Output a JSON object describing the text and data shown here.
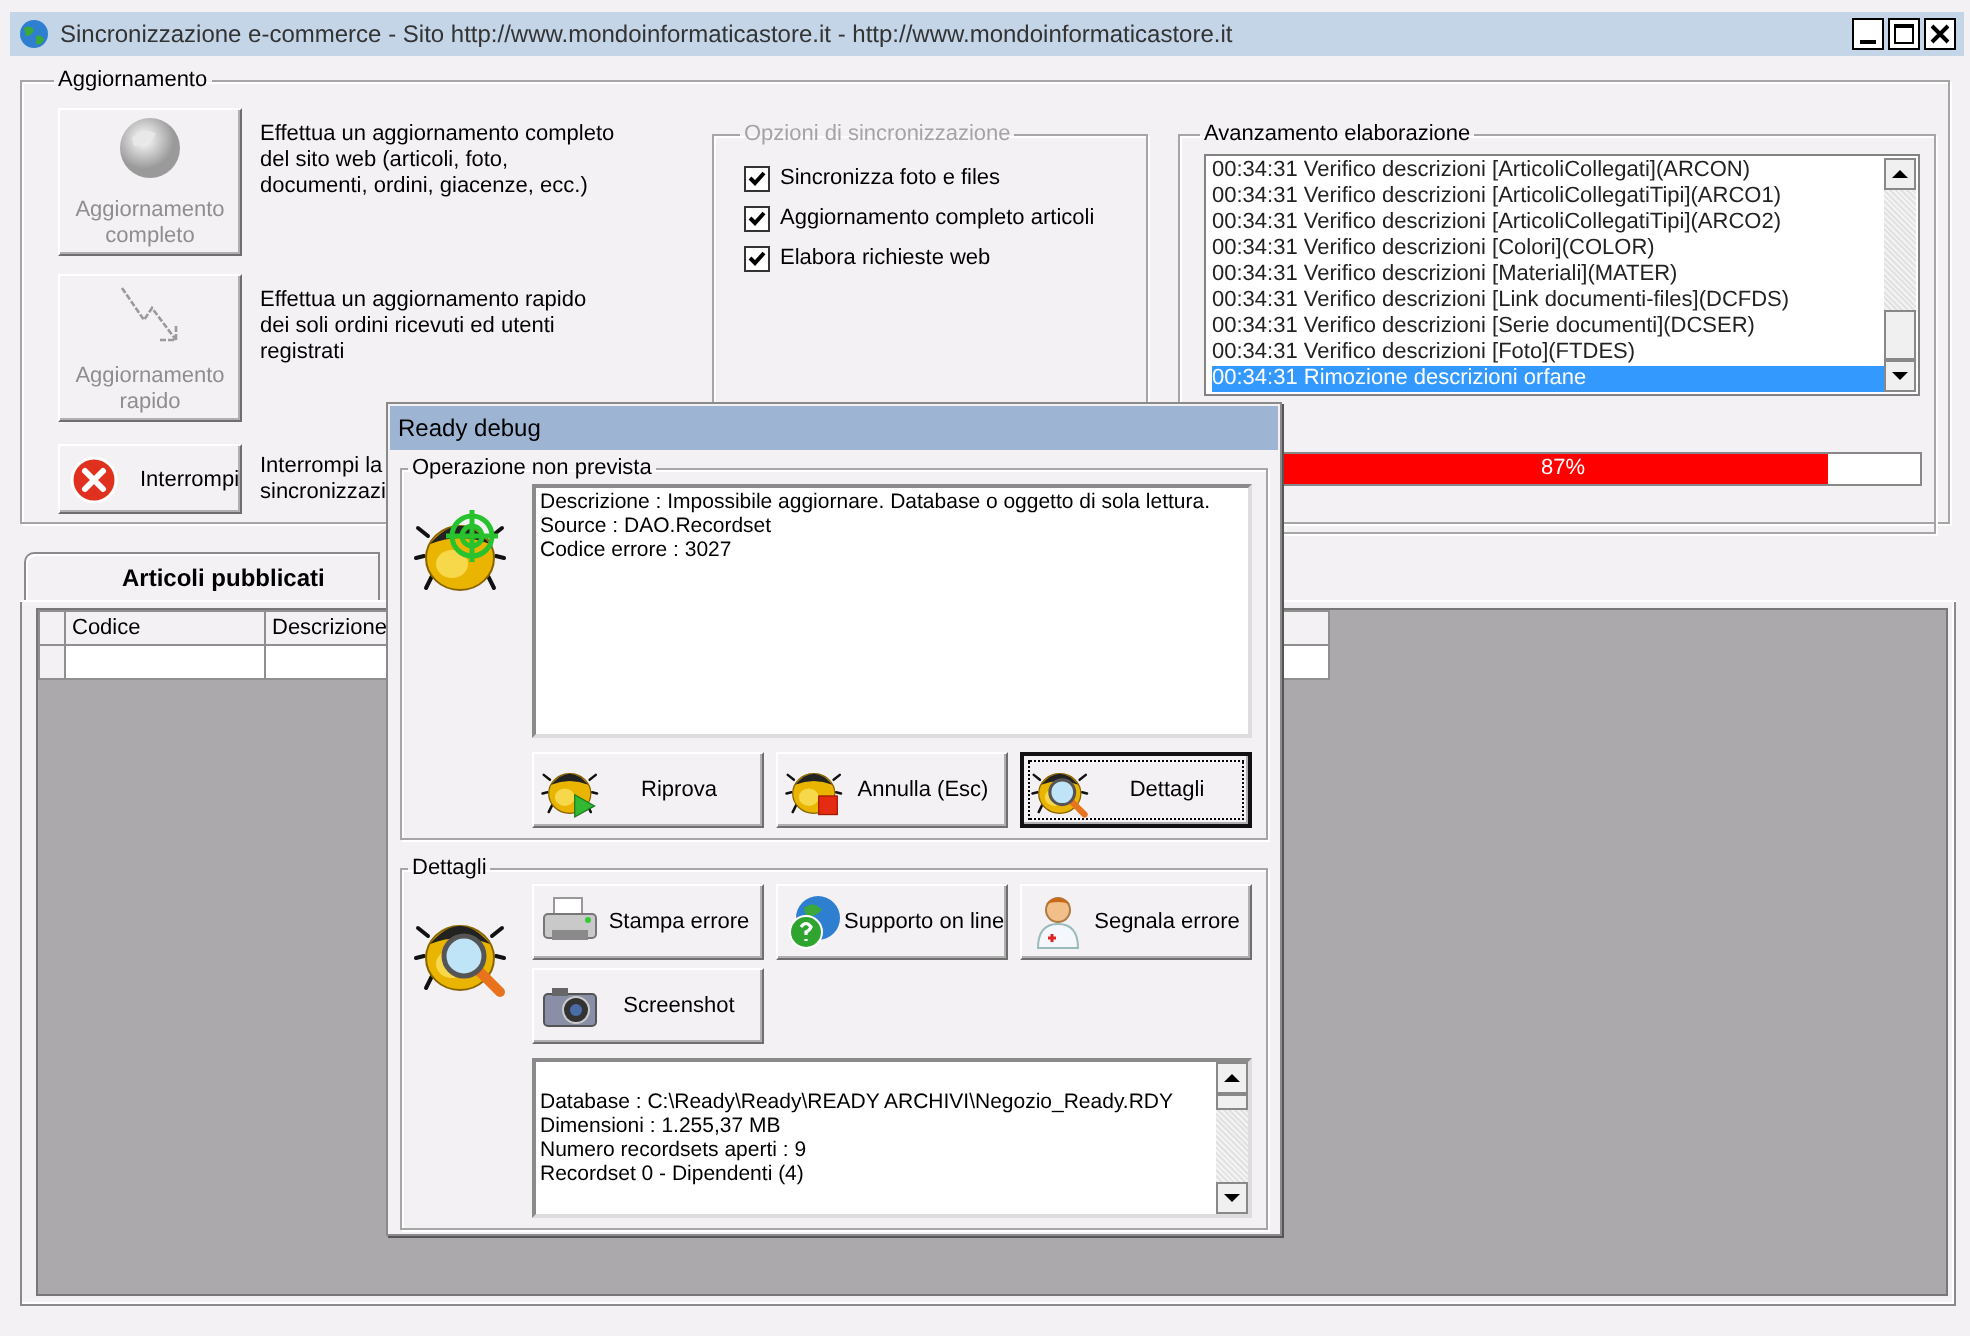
{
  "window": {
    "title": "Sincronizzazione e-commerce - Sito http://www.mondoinformaticastore.it - http://www.mondoinformaticastore.it"
  },
  "update_group": {
    "title": "Aggiornamento",
    "actions": [
      {
        "kind": "full",
        "label": "Aggiornamento completo",
        "description": "Effettua un aggiornamento completo del sito web (articoli, foto, documenti, ordini, giacenze, ecc.)",
        "disabled": true
      },
      {
        "kind": "quick",
        "label": "Aggiornamento rapido",
        "description": "Effettua un aggiornamento rapido dei soli ordini ricevuti ed utenti registrati",
        "disabled": true
      },
      {
        "kind": "stop",
        "label": "Interrompi",
        "description": "Interrompi la\nsincronizzazi",
        "disabled": false
      }
    ],
    "sync_options": {
      "title": "Opzioni di sincronizzazione",
      "disabled": true,
      "options": [
        {
          "label": "Sincronizza foto e files",
          "checked": true
        },
        {
          "label": "Aggiornamento completo articoli",
          "checked": true
        },
        {
          "label": "Elabora richieste web",
          "checked": true
        }
      ]
    },
    "progress": {
      "title": "Avanzamento elaborazione",
      "log": [
        {
          "text": "00:34:31 Verifico descrizioni [ArticoliCollegati](ARCON)",
          "selected": false
        },
        {
          "text": "00:34:31 Verifico descrizioni [ArticoliCollegatiTipi](ARCO1)",
          "selected": false
        },
        {
          "text": "00:34:31 Verifico descrizioni [ArticoliCollegatiTipi](ARCO2)",
          "selected": false
        },
        {
          "text": "00:34:31 Verifico descrizioni [Colori](COLOR)",
          "selected": false
        },
        {
          "text": "00:34:31 Verifico descrizioni [Materiali](MATER)",
          "selected": false
        },
        {
          "text": "00:34:31 Verifico descrizioni [Link documenti-files](DCFDS)",
          "selected": false
        },
        {
          "text": "00:34:31 Verifico descrizioni [Serie documenti](DCSER)",
          "selected": false
        },
        {
          "text": "00:34:31 Verifico descrizioni [Foto](FTDES)",
          "selected": false
        },
        {
          "text": "00:34:31 Rimozione descrizioni orfane",
          "selected": true
        }
      ],
      "level": 0.87,
      "reading": "87%"
    }
  },
  "tabs": [
    {
      "label": "Articoli pubblicati",
      "selected": true
    }
  ],
  "table": {
    "columns": [
      {
        "label": "Codice"
      },
      {
        "label": "Descrizione"
      }
    ]
  },
  "dialog": {
    "title": "Ready debug",
    "error_group": {
      "title": "Operazione non prevista",
      "message": [
        "Descrizione : Impossibile aggiornare. Database o oggetto di sola lettura.",
        "Source : DAO.Recordset",
        "Codice errore : 3027"
      ],
      "buttons": [
        {
          "kind": "retry",
          "label": "Riprova",
          "default": false
        },
        {
          "kind": "cancel",
          "label": "Annulla (Esc)",
          "default": false
        },
        {
          "kind": "details",
          "label": "Dettagli",
          "default": true
        }
      ]
    },
    "details_group": {
      "title": "Dettagli",
      "buttons": [
        {
          "kind": "print",
          "label": "Stampa errore"
        },
        {
          "kind": "support",
          "label": "Supporto on line"
        },
        {
          "kind": "report",
          "label": "Segnala errore"
        },
        {
          "kind": "screenshot",
          "label": "Screenshot"
        }
      ],
      "info": [
        "Database : C:\\Ready\\Ready\\READY ARCHIVI\\Negozio_Ready.RDY",
        "Dimensioni : 1.255,37 MB",
        "Numero recordsets aperti : 9",
        "Recordset 0 - Dipendenti (4)"
      ]
    }
  }
}
